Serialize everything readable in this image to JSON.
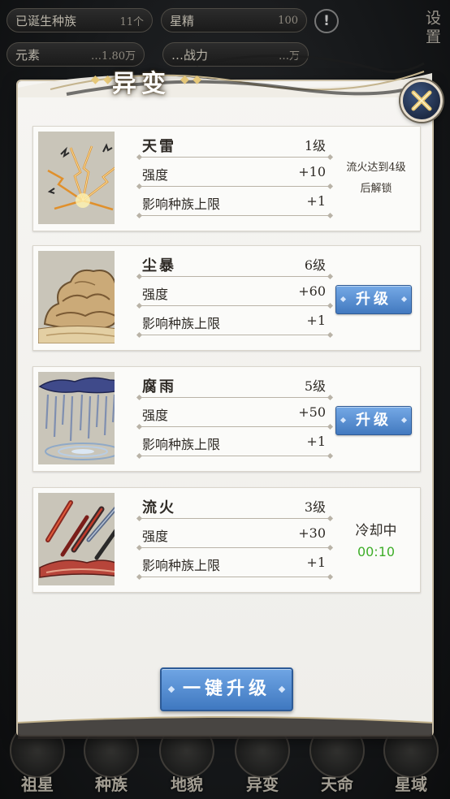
{
  "hud": {
    "born_species_label": "已诞生种族",
    "born_species_value": "11个",
    "star_essence_label": "星精",
    "star_essence_value": "100",
    "element_label": "元素",
    "element_value": "…1.80万",
    "power_label": "…战力",
    "power_value": "…万",
    "alert_icon": "!",
    "settings_label": "设置"
  },
  "panel": {
    "title": "异变",
    "one_click_upgrade": "一键升级"
  },
  "labels": {
    "strength": "强度",
    "species_cap": "影响种族上限",
    "upgrade": "升级"
  },
  "cards": [
    {
      "name": "天雷",
      "level": "1级",
      "strength": "+10",
      "cap": "+1",
      "status": "locked",
      "lock_line1": "流火达到4级",
      "lock_line2": "后解锁",
      "icon": "lightning-icon"
    },
    {
      "name": "尘暴",
      "level": "6级",
      "strength": "+60",
      "cap": "+1",
      "status": "upgradable",
      "icon": "dust-storm-icon"
    },
    {
      "name": "腐雨",
      "level": "5级",
      "strength": "+50",
      "cap": "+1",
      "status": "upgradable",
      "icon": "acid-rain-icon"
    },
    {
      "name": "流火",
      "level": "3级",
      "strength": "+30",
      "cap": "+1",
      "status": "cooldown",
      "cooldown_label": "冷却中",
      "cooldown_time": "00:10",
      "icon": "meteor-fire-icon"
    }
  ],
  "bottom_nav": [
    {
      "label": "祖星"
    },
    {
      "label": "种族"
    },
    {
      "label": "地貌"
    },
    {
      "label": "异变"
    },
    {
      "label": "天命"
    },
    {
      "label": "星域"
    }
  ],
  "colors": {
    "button_blue": "#4279bf",
    "cooldown_green": "#3fae2a",
    "panel_bg": "#f6f5f2",
    "gold_accent": "#e5c779"
  }
}
